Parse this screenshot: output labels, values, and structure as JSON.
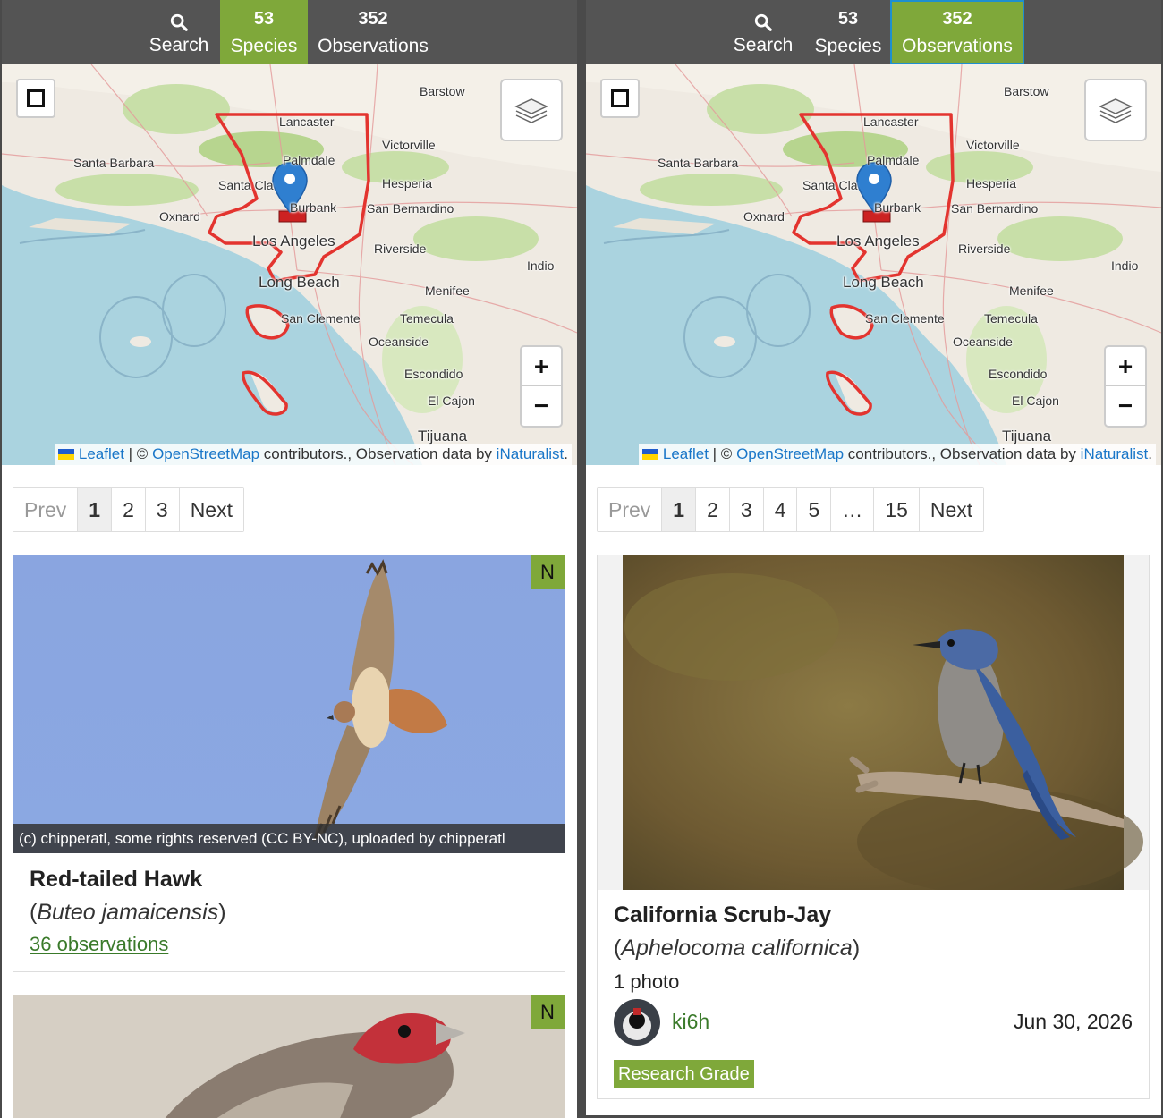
{
  "panels": {
    "left": {
      "nav": {
        "search_label": "Search",
        "species_count": "53",
        "species_label": "Species",
        "observations_count": "352",
        "observations_label": "Observations",
        "active_tab": "species"
      },
      "pagination": [
        "Prev",
        "1",
        "2",
        "3",
        "Next"
      ],
      "current_page": "1",
      "cards": [
        {
          "native_badge": "N",
          "photo_credit": "(c) chipperatl, some rights reserved (CC BY-NC), uploaded by chipperatl",
          "common_name": "Red-tailed Hawk",
          "scientific_name": "Buteo jamaicensis",
          "observations_link": "36 observations"
        },
        {
          "native_badge": "N"
        }
      ]
    },
    "right": {
      "nav": {
        "search_label": "Search",
        "species_count": "53",
        "species_label": "Species",
        "observations_count": "352",
        "observations_label": "Observations",
        "active_tab": "observations"
      },
      "pagination": [
        "Prev",
        "1",
        "2",
        "3",
        "4",
        "5",
        "…",
        "15",
        "Next"
      ],
      "current_page": "1",
      "card": {
        "common_name": "California Scrub-Jay",
        "scientific_name": "Aphelocoma californica",
        "photo_count": "1 photo",
        "user": "ki6h",
        "date": "Jun 30, 2026",
        "quality_grade": "Research Grade"
      }
    }
  },
  "map": {
    "attribution": {
      "leaflet": "Leaflet",
      "sep": " | © ",
      "osm": "OpenStreetMap",
      "middle": " contributors., Observation data by ",
      "inat": "iNaturalist",
      "end": "."
    },
    "labels": [
      "Barstow",
      "Lancaster",
      "Victorville",
      "Santa Barbara",
      "Palmdale",
      "Santa Cla",
      "Hesperia",
      "Burbank",
      "San Bernardino",
      "Oxnard",
      "Los Angeles",
      "Riverside",
      "Indio",
      "Long Beach",
      "Menifee",
      "San Clemente",
      "Temecula",
      "Oceanside",
      "Escondido",
      "El Cajon",
      "Tijuana"
    ],
    "zoom_in": "+",
    "zoom_out": "−",
    "icons": [
      "square-select-icon",
      "layers-icon",
      "map-marker-icon"
    ],
    "colors": {
      "boundary": "#e53935",
      "marker": "#2f7fd0",
      "accent": "#7fa83a"
    }
  }
}
